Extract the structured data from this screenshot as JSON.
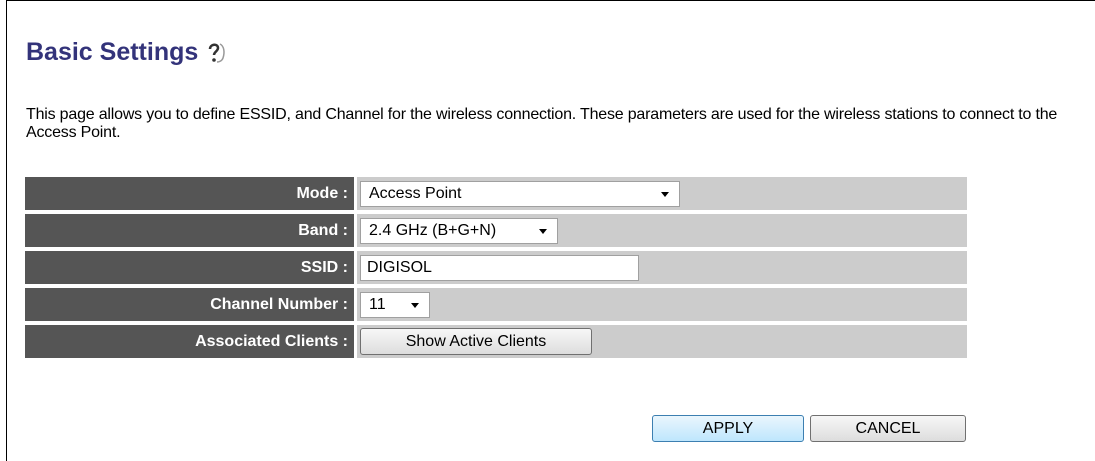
{
  "page": {
    "title": "Basic Settings",
    "description": "This page allows you to define ESSID, and Channel for the wireless connection. These parameters are used for the wireless stations to connect to the Access Point."
  },
  "icons": {
    "help": "help-icon"
  },
  "settings": {
    "mode": {
      "label": "Mode :",
      "value": "Access Point"
    },
    "band": {
      "label": "Band :",
      "value": "2.4 GHz (B+G+N)"
    },
    "ssid": {
      "label": "SSID :",
      "value": "DIGISOL"
    },
    "channel": {
      "label": "Channel Number :",
      "value": "11"
    },
    "clients": {
      "label": "Associated Clients :",
      "button": "Show Active Clients"
    }
  },
  "actions": {
    "apply": "APPLY",
    "cancel": "CANCEL"
  },
  "colors": {
    "label_bg": "#555555",
    "value_bg": "#cccccc",
    "title": "#33337a"
  }
}
